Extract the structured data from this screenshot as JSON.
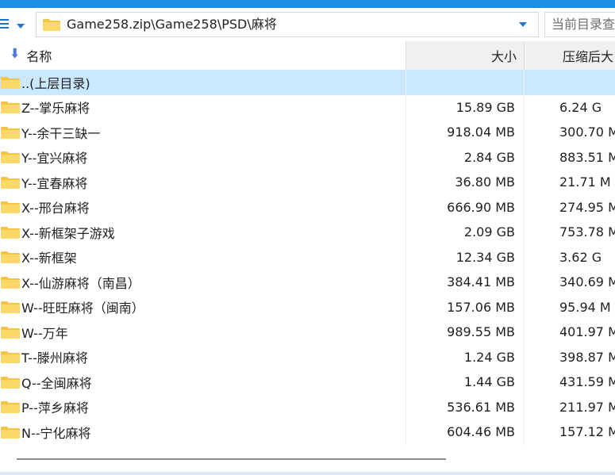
{
  "address_bar": {
    "path": "Game258.zip\\Game258\\PSD\\麻将",
    "search_placeholder": "当前目录查"
  },
  "columns": {
    "name": "名称",
    "size": "大小",
    "packed": "压缩后大"
  },
  "rows": [
    {
      "name": "..(上层目录)",
      "size": "",
      "packed": ""
    },
    {
      "name": "Z--掌乐麻将",
      "size": "15.89 GB",
      "packed": "6.24 G"
    },
    {
      "name": "Y--余干三缺一",
      "size": "918.04 MB",
      "packed": "300.70 M"
    },
    {
      "name": "Y--宜兴麻将",
      "size": "2.84 GB",
      "packed": "883.51 M"
    },
    {
      "name": "Y--宜春麻将",
      "size": "36.80 MB",
      "packed": "21.71 M"
    },
    {
      "name": "X--邢台麻将",
      "size": "666.90 MB",
      "packed": "274.95 M"
    },
    {
      "name": "X--新框架子游戏",
      "size": "2.09 GB",
      "packed": "753.78 M"
    },
    {
      "name": "X--新框架",
      "size": "12.34 GB",
      "packed": "3.62 G"
    },
    {
      "name": "X--仙游麻将（南昌）",
      "size": "384.41 MB",
      "packed": "340.69 M"
    },
    {
      "name": "W--旺旺麻将（闽南）",
      "size": "157.06 MB",
      "packed": "95.94 M"
    },
    {
      "name": "W--万年",
      "size": "989.55 MB",
      "packed": "401.97 M"
    },
    {
      "name": "T--滕州麻将",
      "size": "1.24 GB",
      "packed": "398.87 M"
    },
    {
      "name": "Q--全闽麻将",
      "size": "1.44 GB",
      "packed": "431.59 M"
    },
    {
      "name": "P--萍乡麻将",
      "size": "536.61 MB",
      "packed": "211.97 M"
    },
    {
      "name": "N--宁化麻将",
      "size": "604.46 MB",
      "packed": "157.12 M"
    }
  ],
  "selected_row_index": 0,
  "colors": {
    "accent": "#1a8fe3",
    "selected_row": "#cce8ff",
    "folder": "#f6c444"
  },
  "icons": {
    "menu": "menu-icon",
    "nav_dropdown": "chevron-down-icon",
    "folder": "folder-icon",
    "sort": "sort-down-icon"
  }
}
